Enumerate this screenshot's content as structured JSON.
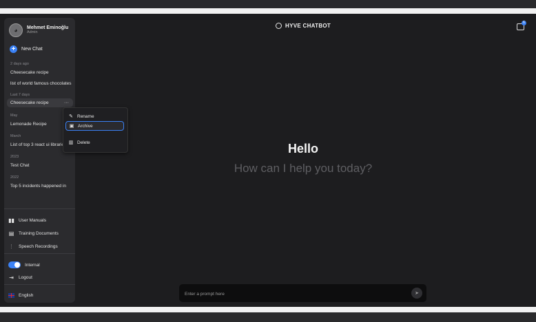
{
  "header": {
    "title": "HYVE CHATBOT",
    "notification_count": "6"
  },
  "user": {
    "name": "Mehmet Eminoğlu",
    "role": "Admin"
  },
  "sidebar": {
    "new_chat_label": "New Chat",
    "groups": [
      {
        "label": "2 days ago",
        "chats": [
          "Cheesecake recipe",
          "list of world famous chocolates"
        ]
      },
      {
        "label": "Last 7 days",
        "chats": [
          "Cheesecake recipe"
        ]
      },
      {
        "label": "May",
        "chats": [
          "Lemonade Recipe"
        ]
      },
      {
        "label": "March",
        "chats": [
          "List of top 3 react ui libraries"
        ]
      },
      {
        "label": "2023",
        "chats": [
          "Test Chat"
        ]
      },
      {
        "label": "2022",
        "chats": [
          "Top 5 incidents happened in"
        ]
      }
    ],
    "more_glyph": "···",
    "tools": {
      "user_manuals": "User Manuals",
      "training_documents": "Training Documents",
      "speech_recordings": "Speech Recordings"
    },
    "internal_label": "Internal",
    "internal_on": true,
    "logout_label": "Logout",
    "language_label": "English"
  },
  "context_menu": {
    "rename": "Rename",
    "archive": "Archive",
    "delete": "Delete"
  },
  "main": {
    "greeting": "Hello",
    "subtitle": "How can I help you today?"
  },
  "prompt": {
    "placeholder": "Enter a prompt here"
  },
  "colors": {
    "accent": "#3b82f6",
    "background": "#1d1d1f",
    "sidebar": "#2b2b2e"
  }
}
